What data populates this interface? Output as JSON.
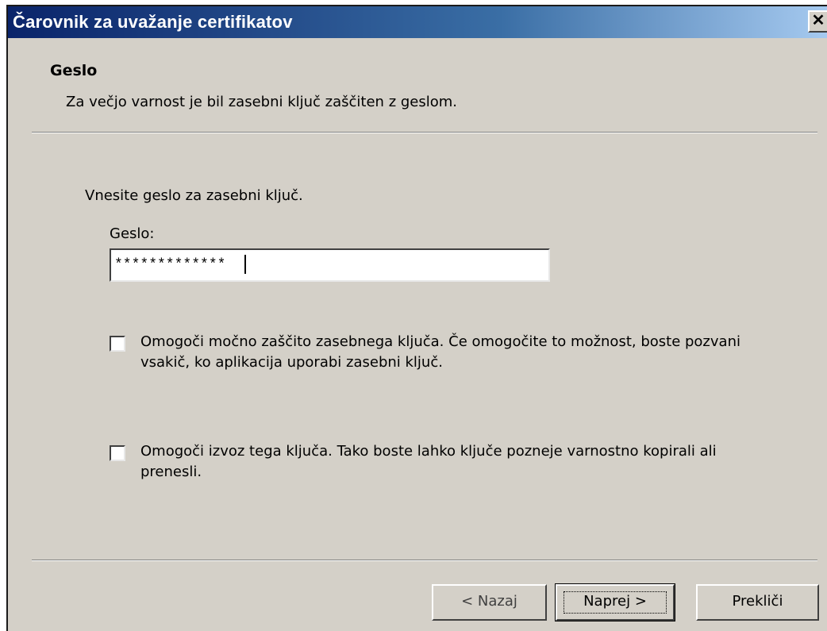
{
  "window": {
    "title": "Čarovnik za uvažanje certifikatov",
    "close_glyph": "✕"
  },
  "header": {
    "title": "Geslo",
    "subtitle": "Za večjo varnost je bil zasebni ključ zaščiten z geslom."
  },
  "body": {
    "prompt": "Vnesite geslo za zasebni ključ.",
    "password_label": "Geslo:",
    "password_value": "*************",
    "checkbox_strong": {
      "checked": false,
      "label": "Omogoči močno zaščito zasebnega ključa. Če omogočite to možnost, boste pozvani vsakič, ko aplikacija uporabi zasebni ključ."
    },
    "checkbox_export": {
      "checked": false,
      "label": "Omogoči izvoz tega ključa. Tako boste lahko ključe pozneje varnostno kopirali ali prenesli."
    }
  },
  "buttons": {
    "back": "< Nazaj",
    "next": "Naprej >",
    "cancel": "Prekliči"
  }
}
